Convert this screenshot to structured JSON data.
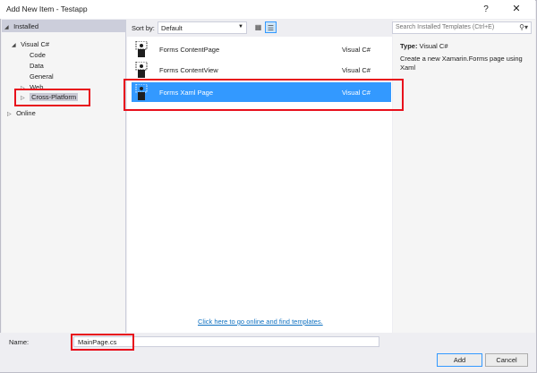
{
  "window": {
    "title": "Add New Item - Testapp",
    "help": "?",
    "close": "✕"
  },
  "tree": {
    "installed": "Installed",
    "visual_csharp": "Visual C#",
    "children": [
      {
        "label": "Code",
        "arrow": ""
      },
      {
        "label": "Data",
        "arrow": ""
      },
      {
        "label": "General",
        "arrow": ""
      },
      {
        "label": "Web",
        "arrow": "▷"
      },
      {
        "label": "Cross-Platform",
        "arrow": "▷"
      }
    ],
    "online": "Online"
  },
  "toolbar": {
    "sort_label": "Sort by:",
    "sort_value": "Default"
  },
  "templates": [
    {
      "name": "Forms ContentPage",
      "lang": "Visual C#"
    },
    {
      "name": "Forms ContentView",
      "lang": "Visual C#"
    },
    {
      "name": "Forms Xaml Page",
      "lang": "Visual C#"
    }
  ],
  "online_link": "Click here to go online and find templates.",
  "search": {
    "placeholder": "Search Installed Templates (Ctrl+E)"
  },
  "details": {
    "type_label": "Type:",
    "type_value": "Visual C#",
    "description": "Create a new Xamarin.Forms page using Xaml"
  },
  "footer": {
    "name_label": "Name:",
    "name_value": "MainPage.cs",
    "add": "Add",
    "cancel": "Cancel"
  },
  "colors": {
    "selection": "#3399ff",
    "highlight": "#e8101c",
    "link": "#0e70c0"
  }
}
